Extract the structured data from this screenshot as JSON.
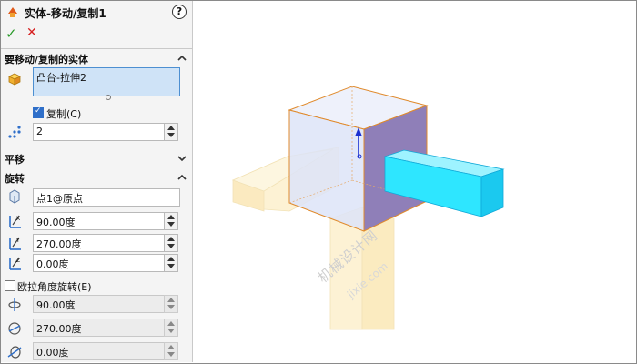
{
  "header": {
    "title": "实体-移动/复制1",
    "help_label": "?"
  },
  "actions": {
    "ok_label": "✓",
    "cancel_label": "✕"
  },
  "bodies_section": {
    "title": "要移动/复制的实体",
    "selected_body": "凸台-拉伸2",
    "copy_label": "复制(C)",
    "copy_checked": true,
    "copy_count": "2"
  },
  "translate_section": {
    "title": "平移",
    "collapsed": true
  },
  "rotate_section": {
    "title": "旋转",
    "point": "点1@原点",
    "x_angle": "90.00度",
    "y_angle": "270.00度",
    "z_angle": "0.00度",
    "euler_label": "欧拉角度旋转(E)",
    "euler_checked": false,
    "euler_1": "90.00度",
    "euler_2": "270.00度",
    "euler_3": "0.00度"
  },
  "watermark": {
    "line1": "机械设计网",
    "line2": "jixie.com"
  },
  "colors": {
    "selection": "#cfe3f7",
    "highlight_body": "#29e3ff",
    "copy_body": "#fdf2cf",
    "edge": "#e08a2c"
  }
}
